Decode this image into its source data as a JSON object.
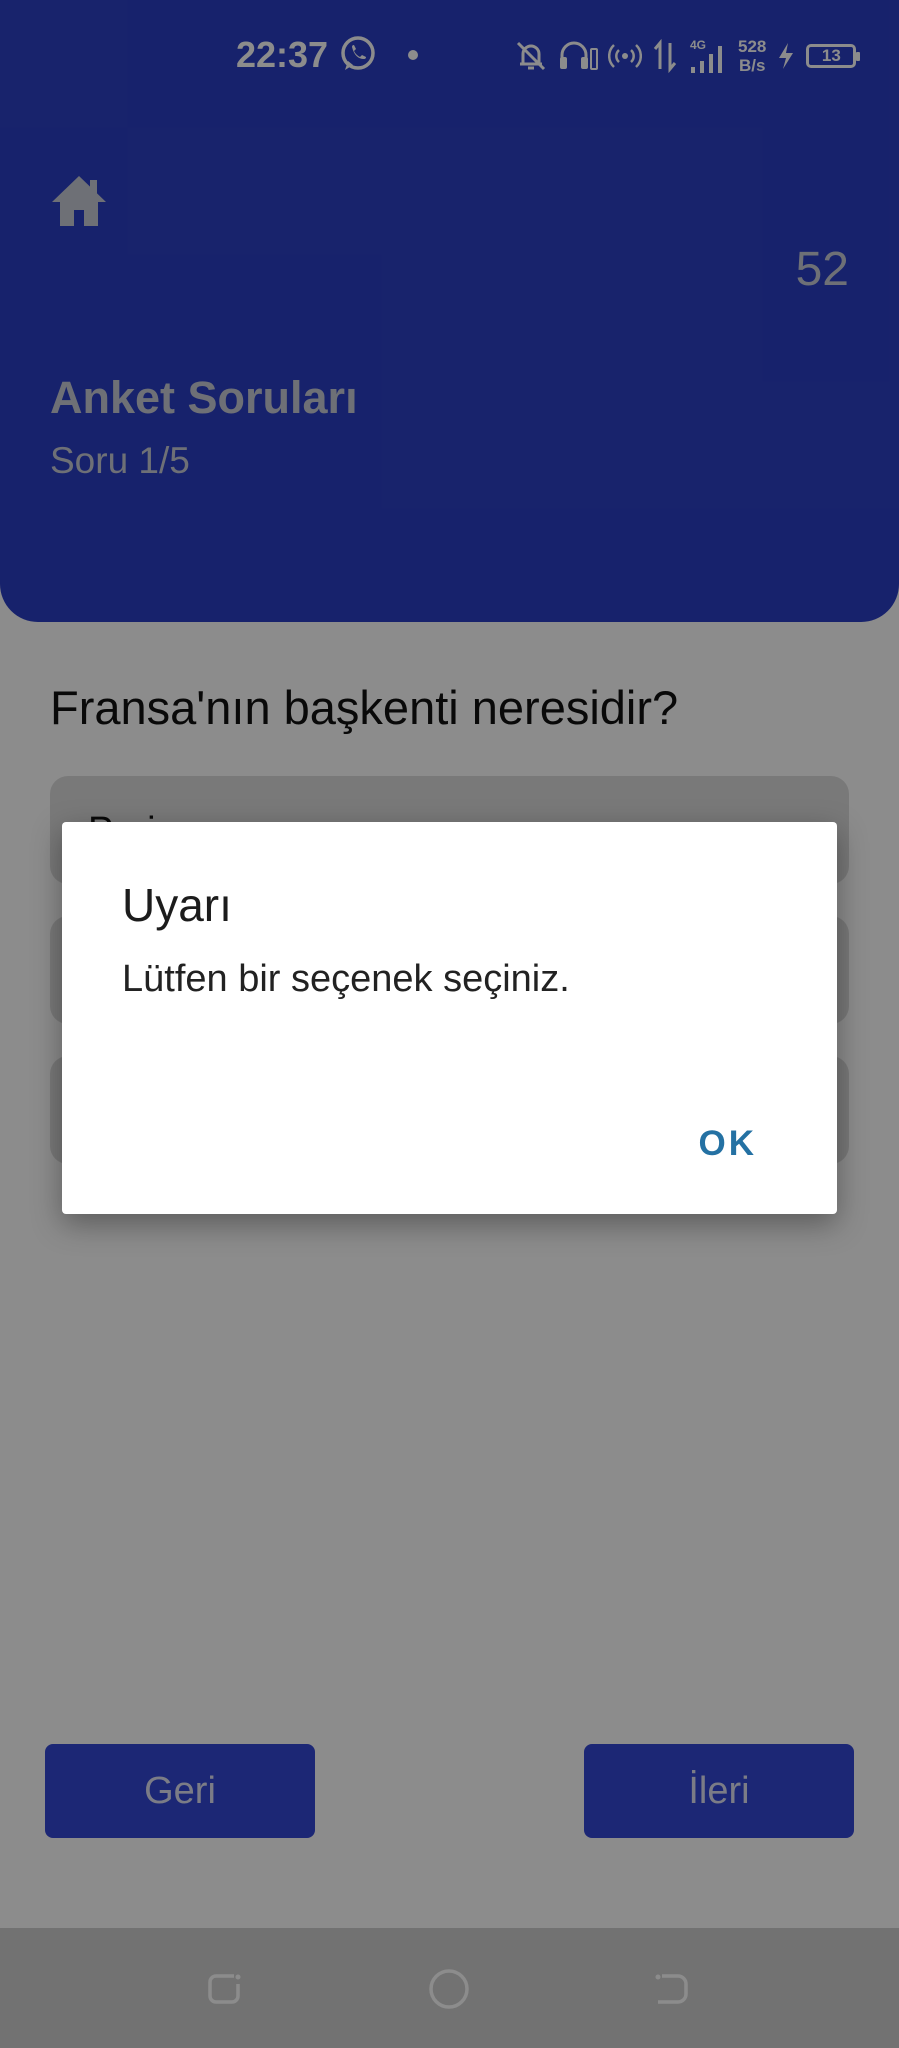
{
  "status_bar": {
    "time": "22:37",
    "speed_value": "528",
    "speed_unit": "B/s",
    "network": "4G",
    "battery": "13"
  },
  "header": {
    "timer": "52",
    "title": "Anket Soruları",
    "subtitle": "Soru 1/5"
  },
  "question": {
    "text": "Fransa'nın başkenti neresidir?",
    "options": [
      "Paris",
      "",
      ""
    ]
  },
  "navigation": {
    "back_label": "Geri",
    "next_label": "İleri"
  },
  "dialog": {
    "title": "Uyarı",
    "message": "Lütfen bir seçenek seçiniz.",
    "ok_label": "OK"
  },
  "colors": {
    "header_bg": "#2b3fc5",
    "button_bg": "#3347d6",
    "dialog_action": "#2471a3"
  }
}
